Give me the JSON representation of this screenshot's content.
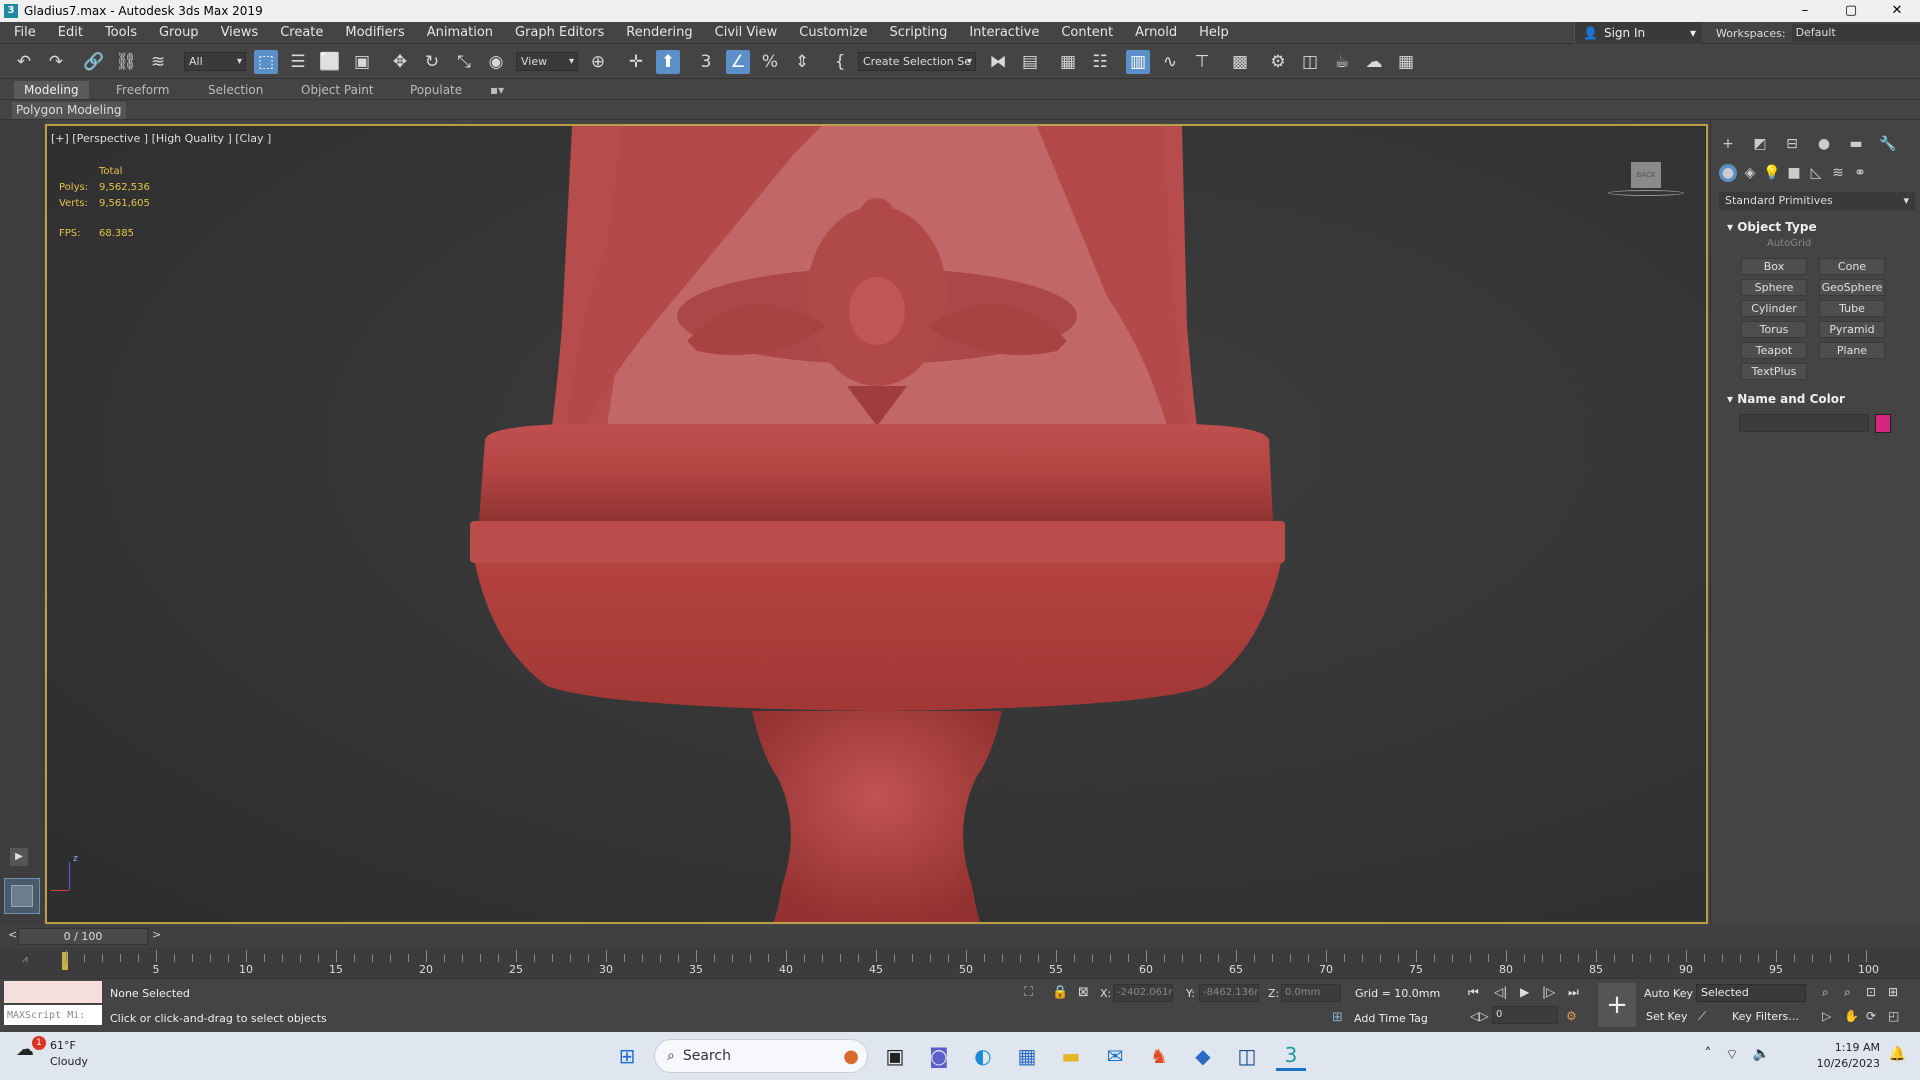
{
  "window": {
    "title": "Gladius7.max - Autodesk 3ds Max 2019",
    "app_icon": "3",
    "minimize": "–",
    "maximize": "▢",
    "close": "✕"
  },
  "menu": [
    "File",
    "Edit",
    "Tools",
    "Group",
    "Views",
    "Create",
    "Modifiers",
    "Animation",
    "Graph Editors",
    "Rendering",
    "Civil View",
    "Customize",
    "Scripting",
    "Interactive",
    "Content",
    "Arnold",
    "Help"
  ],
  "signin": {
    "label": "Sign In"
  },
  "workspaces": {
    "label": "Workspaces:",
    "value": "Default"
  },
  "toolbar": {
    "filter_value": "All",
    "refcoord_value": "View",
    "selection_set_value": "Create Selection Se"
  },
  "ribbon": {
    "tabs": [
      "Modeling",
      "Freeform",
      "Selection",
      "Object Paint",
      "Populate"
    ],
    "active_tab": "Modeling",
    "sub_label": "Polygon Modeling"
  },
  "viewport": {
    "label": "[+] [Perspective ] [High Quality ] [Clay ]",
    "stats": {
      "total_label": "Total",
      "polys_label": "Polys:",
      "polys": "9,562,536",
      "verts_label": "Verts:",
      "verts": "9,561,605",
      "fps_label": "FPS:",
      "fps": "68.385"
    },
    "viewcube_label": "BACK",
    "axis_label": "z"
  },
  "command_panel": {
    "dropdown": "Standard Primitives",
    "object_type_title": "Object Type",
    "autogrid": "AutoGrid",
    "buttons": [
      "Box",
      "Cone",
      "Sphere",
      "GeoSphere",
      "Cylinder",
      "Tube",
      "Torus",
      "Pyramid",
      "Teapot",
      "Plane",
      "TextPlus"
    ],
    "name_color_title": "Name and Color",
    "color": "#d4267a"
  },
  "timeslider": {
    "value": "0 / 100",
    "prev": "<",
    "next": ">",
    "ticks": [
      "5",
      "10",
      "15",
      "20",
      "25",
      "30",
      "35",
      "40",
      "45",
      "50",
      "55",
      "60",
      "65",
      "70",
      "75",
      "80",
      "85",
      "90",
      "95",
      "100"
    ]
  },
  "statusbar": {
    "maxscript": "MAXScript Mi:",
    "selection": "None Selected",
    "prompt": "Click or click-and-drag to select objects",
    "x_label": "X:",
    "x_value": "-2402.061r",
    "y_label": "Y:",
    "y_value": "-8462.136r",
    "z_label": "Z:",
    "z_value": "0.0mm",
    "grid": "Grid = 10.0mm",
    "add_time_tag": "Add Time Tag",
    "auto_key": "Auto Key",
    "set_key": "Set Key",
    "key_mode": "Selected",
    "frame": "0",
    "key_filters": "Key Filters..."
  },
  "taskbar": {
    "weather_temp": "61°F",
    "weather_cond": "Cloudy",
    "weather_badge": "1",
    "search": "Search",
    "time": "1:19 AM",
    "date": "10/26/2023"
  }
}
